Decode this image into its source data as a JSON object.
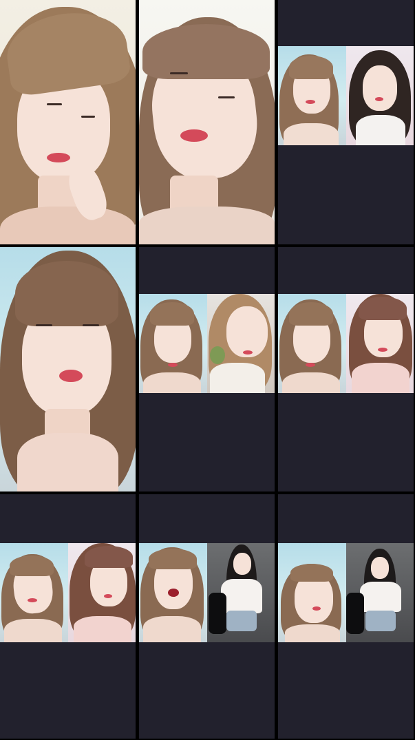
{
  "screen": {
    "title": "",
    "background": "#000000",
    "placeholder_color": "#22212d"
  },
  "tiles": [
    {
      "index": 1,
      "type": "single-portrait",
      "label": ""
    },
    {
      "index": 2,
      "type": "single-portrait",
      "label": ""
    },
    {
      "index": 3,
      "type": "split-portrait",
      "label": ""
    },
    {
      "index": 4,
      "type": "single-portrait",
      "label": ""
    },
    {
      "index": 5,
      "type": "split-portrait",
      "label": ""
    },
    {
      "index": 6,
      "type": "split-portrait",
      "label": ""
    },
    {
      "index": 7,
      "type": "split-portrait",
      "label": ""
    },
    {
      "index": 8,
      "type": "split-portrait",
      "label": ""
    },
    {
      "index": 9,
      "type": "split-portrait",
      "label": ""
    }
  ]
}
